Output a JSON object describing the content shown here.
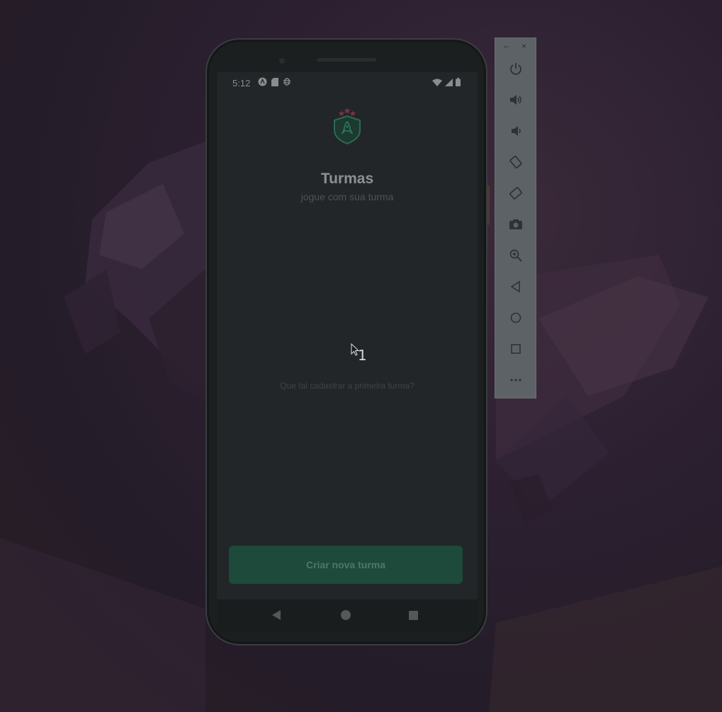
{
  "status_bar": {
    "time": "5:12",
    "left_icons": [
      "app-notification-icon",
      "sd-card-icon",
      "debug-icon"
    ],
    "right_icons": [
      "wifi-icon",
      "signal-icon",
      "battery-icon"
    ]
  },
  "app": {
    "title": "Turmas",
    "subtitle": "jogue com sua turma",
    "empty_message": "Que tal cadastrar a primeira turma?",
    "create_button_label": "Criar nova turma"
  },
  "nav_bar": {
    "buttons": [
      "back-icon",
      "home-icon",
      "recents-icon"
    ]
  },
  "emulator_toolbar": {
    "window_controls": [
      "–",
      "×"
    ],
    "buttons": [
      "power-icon",
      "volume-up-icon",
      "volume-down-icon",
      "rotate-left-icon",
      "rotate-right-icon",
      "screenshot-icon",
      "zoom-icon",
      "back-icon",
      "home-icon",
      "overview-icon",
      "more-icon"
    ]
  },
  "cursor": {
    "label": "1"
  },
  "colors": {
    "screen_bg": "#222628",
    "button_bg": "#1d4a3a",
    "button_text": "#4f7767",
    "accent_star": "#8a3b45"
  }
}
